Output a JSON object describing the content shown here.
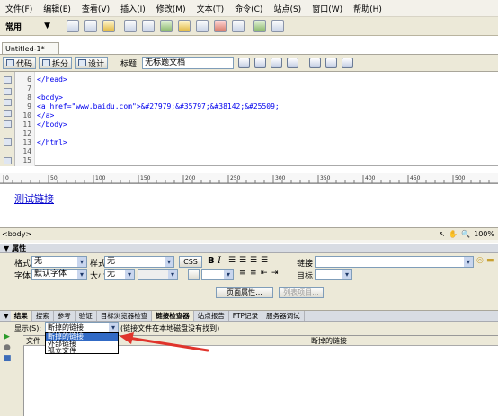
{
  "menu": [
    "文件(F)",
    "编辑(E)",
    "查看(V)",
    "插入(I)",
    "修改(M)",
    "文本(T)",
    "命令(C)",
    "站点(S)",
    "窗口(W)",
    "帮助(H)"
  ],
  "toolbar": {
    "category": "常用"
  },
  "document": {
    "tab_name": "Untitled-1*",
    "views": {
      "code": "代码",
      "split": "拆分",
      "design": "设计"
    },
    "title_label": "标题:",
    "title_value": "无标题文档"
  },
  "code": {
    "line_numbers": [
      "6",
      "7",
      "8",
      "9",
      "10",
      "11",
      "12",
      "13",
      "14",
      "15"
    ],
    "lines": [
      "</head>",
      "",
      "<body>",
      "<a href=\"www.baidu.com\">&#27979;&#35797;&#38142;&#25509;",
      "</a>",
      "</body>",
      "",
      "</html>",
      "",
      ""
    ]
  },
  "design": {
    "link_text": "测试链接"
  },
  "status": {
    "tag": "<body>",
    "zoom": "100%"
  },
  "properties": {
    "title": "属性",
    "format_label": "格式",
    "format_value": "无",
    "style_label": "样式",
    "style_value": "无",
    "css_button": "CSS",
    "link_label": "链接",
    "font_label": "字体",
    "font_value": "默认字体",
    "size_label": "大小",
    "size_value": "无",
    "target_label": "目标",
    "page_props_button": "页面属性...",
    "list_item_button": "列表项目..."
  },
  "results": {
    "title": "结果",
    "tabs": [
      "搜索",
      "参考",
      "验证",
      "目标浏览器检查",
      "链接检查器",
      "站点报告",
      "FTP记录",
      "服务器调试"
    ],
    "show_label": "显示(S):",
    "show_value": "断掉的链接",
    "note": "(链接文件在本地磁盘没有找到)",
    "col_file": "文件",
    "col_broken": "断掉的链接",
    "dropdown_options": [
      "断掉的链接",
      "外部链接",
      "孤立文件"
    ]
  },
  "colors": {
    "accent": "#316ac5",
    "arrow": "#e0342c",
    "link": "#0000cc"
  }
}
